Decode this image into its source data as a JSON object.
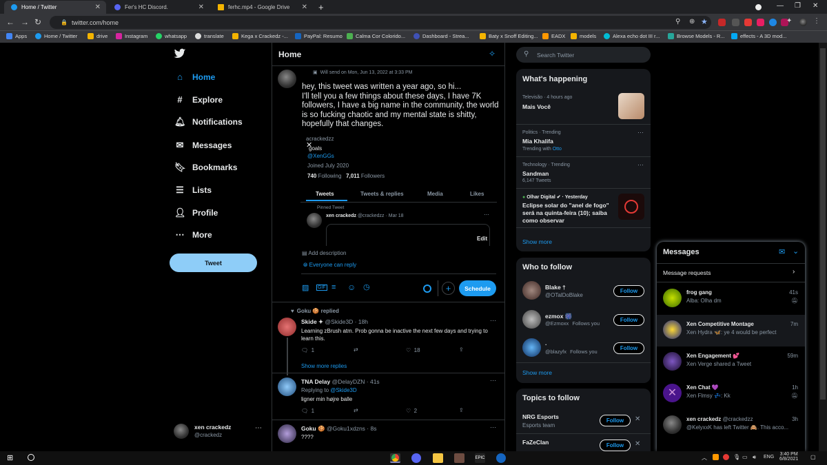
{
  "tabs": [
    {
      "label": "Home / Twitter",
      "active": true
    },
    {
      "label": "Fer's HC Discord."
    },
    {
      "label": "ferhc.mp4 - Google Drive"
    }
  ],
  "omnibox": {
    "url": "twitter.com/home"
  },
  "bookmarks": [
    "Apps",
    "Home / Twitter",
    "drive",
    "Instagram",
    "whatsapp",
    "translate",
    "Kega x Crackedz -...",
    "PayPal: Resumo",
    "Calma Cor Colorido...",
    "Dashboard - Strea...",
    "Baty x Snoff Editing...",
    "EADX",
    "models",
    "Alexa echo dot III r...",
    "Browse Models - R...",
    "effects - A 3D mod..."
  ],
  "nav": {
    "home": "Home",
    "explore": "Explore",
    "notifications": "Notifications",
    "messages": "Messages",
    "bookmarks": "Bookmarks",
    "lists": "Lists",
    "profile": "Profile",
    "more": "More",
    "tweet": "Tweet"
  },
  "account": {
    "name": "xen crackedz",
    "handle": "@crackedz"
  },
  "header": {
    "title": "Home"
  },
  "compose": {
    "schedule_note": "Will send on Mon, Jun 13, 2022 at 3:33 PM",
    "text": "hey, this tweet was written a year ago, so hi...\nI'll tell you a few things about these days, I have 7K followers, I have a big name in the community, the world is so fucking chaotic and my mental state is shitty, hopefully that changes.",
    "add_description": "Add description",
    "everyone_can_reply": "Everyone can reply",
    "schedule_button": "Schedule"
  },
  "embed": {
    "handle_top": "acrackedzz",
    "goals": "goals",
    "link": "@XenGGs",
    "joined": "Joined July 2020",
    "following": "740",
    "following_label": "Following",
    "followers": "7,011",
    "followers_label": "Followers",
    "tabs": [
      "Tweets",
      "Tweets & replies",
      "Media",
      "Likes"
    ],
    "pinned": "Pinned Tweet",
    "pinned_name": "xen crackedz",
    "pinned_handle": "@crackedzz · Mar 18",
    "edit": "Edit"
  },
  "feed": {
    "replied": "Goku 🍪 replied",
    "t1": {
      "name": "Skide ✦",
      "handle": "@Skide3D · 18h",
      "text": "Learning zBrush atm. Prob gonna be inactive the next few days and trying to learn this.",
      "replies": "1",
      "likes": "18"
    },
    "show_more": "Show more replies",
    "t2": {
      "name": "TNA Delay",
      "handle": "@DelayDZN · 41s",
      "replying": "Replying to",
      "replying_to": "@Skide3D",
      "text": "ligner min højre balle",
      "replies": "1",
      "likes": "2"
    },
    "t3": {
      "name": "Goku 🍪",
      "handle": "@Goku1xdzns · 8s",
      "text": "????"
    }
  },
  "search": {
    "placeholder": "Search Twitter"
  },
  "happening": {
    "title": "What's happening",
    "items": [
      {
        "meta": "Televisão · 4 hours ago",
        "title": "Mais Você"
      },
      {
        "meta": "Politics · Trending",
        "title": "Mia Khalifa",
        "sub": "Trending with",
        "sub_link": "Otto"
      },
      {
        "meta": "Technology · Trending",
        "title": "Sandman",
        "sub": "6,147 Tweets"
      },
      {
        "meta": "Olhar Digital ✔ · Yesterday",
        "title": "Eclipse solar do \"anel de fogo\" será na quinta-feira (10); saiba como observar"
      }
    ],
    "show_more": "Show more"
  },
  "who": {
    "title": "Who to follow",
    "items": [
      {
        "name": "Blake †",
        "handle": "@OTalDoBlake",
        "follows": ""
      },
      {
        "name": "ezmox 🎆",
        "handle": "@Ezmoxx",
        "follows": "Follows you"
      },
      {
        "name": ".",
        "handle": "@blazyfx",
        "follows": "Follows you"
      }
    ],
    "follow": "Follow",
    "show_more": "Show more"
  },
  "topics": {
    "title": "Topics to follow",
    "items": [
      {
        "name": "NRG Esports",
        "sub": "Esports team"
      },
      {
        "name": "FaZeClan",
        "sub": ""
      }
    ],
    "follow": "Follow"
  },
  "messages": {
    "title": "Messages",
    "requests": "Message requests",
    "items": [
      {
        "name": "frog gang",
        "preview": "Alba: Olha dm",
        "time": "41s"
      },
      {
        "name": "Xen Competitive Montage",
        "preview": "Xen Hydra 🦋: ye 4 would be perfect",
        "time": "7m"
      },
      {
        "name": "Xen Engagement 💕",
        "preview": "Xen Verge shared a Tweet",
        "time": "59m"
      },
      {
        "name": "Xen Chat 💜",
        "preview": "Xen Flmsy 💤: Kk",
        "time": "1h"
      },
      {
        "name": "xen crackedz",
        "handle": "@crackedzz",
        "preview": "@KelyxxK has left Twitter 🙈. This acco...",
        "time": "3h"
      }
    ]
  },
  "taskbar": {
    "lang": "ENG",
    "time": "3:40 PM",
    "date": "6/8/2021"
  },
  "colors": {
    "accent": "#1d9bf0",
    "bg": "#000000",
    "panel": "#16181c"
  }
}
